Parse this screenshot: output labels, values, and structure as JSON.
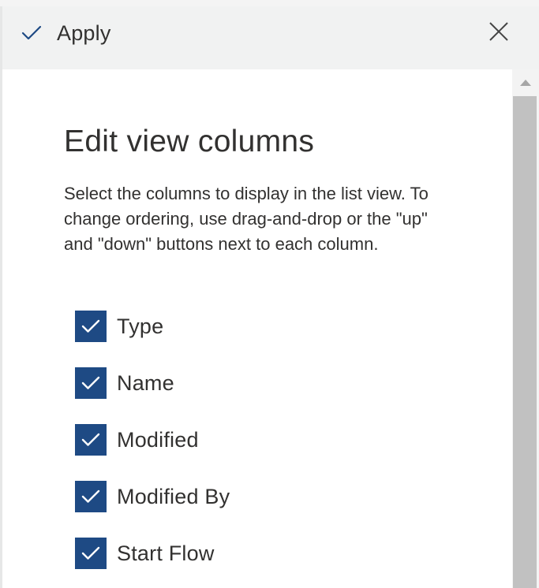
{
  "header": {
    "apply_label": "Apply",
    "apply_icon": "checkmark-icon",
    "close_icon": "close-icon"
  },
  "panel": {
    "title": "Edit view columns",
    "description": "Select the columns to display in the list view. To change ordering, use drag-and-drop or the \"up\" and \"down\" buttons next to each column."
  },
  "columns": [
    {
      "label": "Type",
      "checked": true
    },
    {
      "label": "Name",
      "checked": true
    },
    {
      "label": "Modified",
      "checked": true
    },
    {
      "label": "Modified By",
      "checked": true
    },
    {
      "label": "Start Flow",
      "checked": true
    }
  ],
  "colors": {
    "accent": "#1e4a84",
    "header_bg": "#f1f2f2",
    "text": "#323130"
  }
}
